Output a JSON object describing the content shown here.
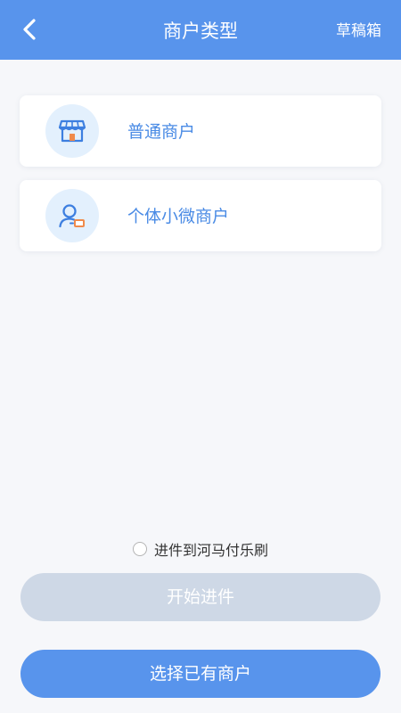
{
  "header": {
    "back_icon": "chevron-left-icon",
    "title": "商户类型",
    "right_label": "草稿箱",
    "background": "#5894ec"
  },
  "merchant_types": [
    {
      "label": "普通商户",
      "icon": "storefront-icon"
    },
    {
      "label": "个体小微商户",
      "icon": "person-card-icon"
    }
  ],
  "agreement": {
    "label": "进件到河马付乐刷",
    "checked": false
  },
  "buttons": {
    "start_label": "开始进件",
    "start_disabled": true,
    "select_existing_label": "选择已有商户"
  },
  "colors": {
    "accent": "#5894ec",
    "label_blue": "#4a8be5",
    "disabled_button": "#ced8e6",
    "icon_circle": "#e3f0fd",
    "badge_orange": "#f08a4b"
  }
}
